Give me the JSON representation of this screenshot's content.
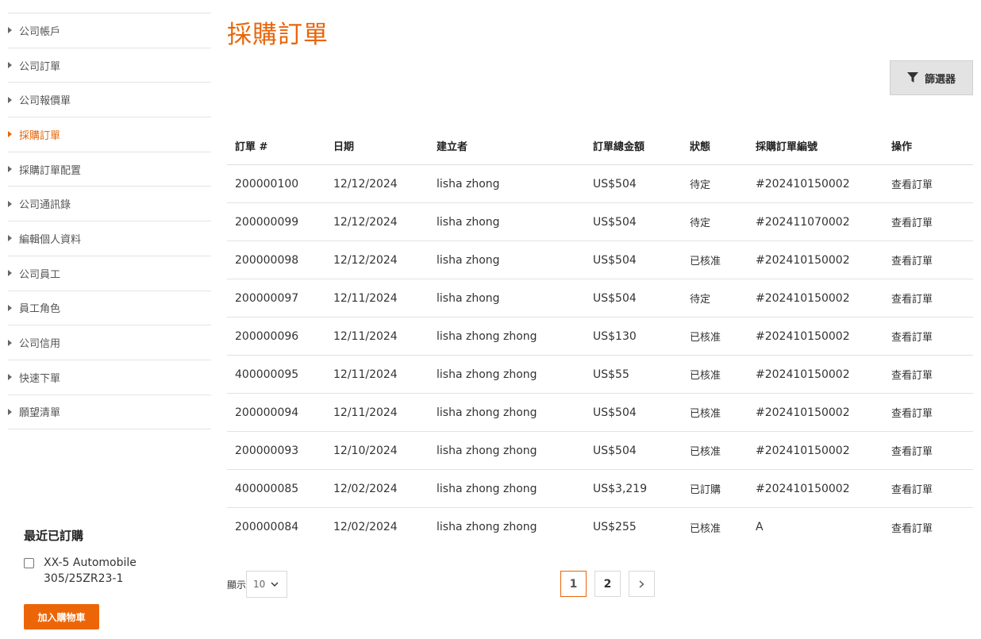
{
  "sidebar": {
    "items": [
      {
        "label": "公司帳戶",
        "active": false
      },
      {
        "label": "公司訂單",
        "active": false
      },
      {
        "label": "公司報價單",
        "active": false
      },
      {
        "label": "採購訂單",
        "active": true
      },
      {
        "label": "採購訂單配置",
        "active": false
      },
      {
        "label": "公司通訊錄",
        "active": false
      },
      {
        "label": "編輯個人資料",
        "active": false
      },
      {
        "label": "公司員工",
        "active": false
      },
      {
        "label": "員工角色",
        "active": false
      },
      {
        "label": "公司信用",
        "active": false
      },
      {
        "label": "快速下單",
        "active": false
      },
      {
        "label": "願望清單",
        "active": false
      }
    ]
  },
  "recent": {
    "title": "最近已訂購",
    "item_label": "XX-5 Automobile 305/25ZR23-1",
    "add_to_cart_label": "加入購物車"
  },
  "page": {
    "title": "採購訂單",
    "filter_label": "篩選器"
  },
  "table": {
    "headers": [
      "訂單 #",
      "日期",
      "建立者",
      "訂單總金額",
      "狀態",
      "採購訂單編號",
      "操作"
    ],
    "rows": [
      {
        "order": "200000100",
        "date": "12/12/2024",
        "creator": "lisha zhong",
        "total": "US$504",
        "status": "待定",
        "po": "#202410150002",
        "action": "查看訂單"
      },
      {
        "order": "200000099",
        "date": "12/12/2024",
        "creator": "lisha zhong",
        "total": "US$504",
        "status": "待定",
        "po": "#202411070002",
        "action": "查看訂單"
      },
      {
        "order": "200000098",
        "date": "12/12/2024",
        "creator": "lisha zhong",
        "total": "US$504",
        "status": "已核准",
        "po": "#202410150002",
        "action": "查看訂單"
      },
      {
        "order": "200000097",
        "date": "12/11/2024",
        "creator": "lisha zhong",
        "total": "US$504",
        "status": "待定",
        "po": "#202410150002",
        "action": "查看訂單"
      },
      {
        "order": "200000096",
        "date": "12/11/2024",
        "creator": "lisha zhong zhong",
        "total": "US$130",
        "status": "已核准",
        "po": "#202410150002",
        "action": "查看訂單"
      },
      {
        "order": "400000095",
        "date": "12/11/2024",
        "creator": "lisha zhong zhong",
        "total": "US$55",
        "status": "已核准",
        "po": "#202410150002",
        "action": "查看訂單"
      },
      {
        "order": "200000094",
        "date": "12/11/2024",
        "creator": "lisha zhong zhong",
        "total": "US$504",
        "status": "已核准",
        "po": "#202410150002",
        "action": "查看訂單"
      },
      {
        "order": "200000093",
        "date": "12/10/2024",
        "creator": "lisha zhong zhong",
        "total": "US$504",
        "status": "已核准",
        "po": "#202410150002",
        "action": "查看訂單"
      },
      {
        "order": "400000085",
        "date": "12/02/2024",
        "creator": "lisha zhong zhong",
        "total": "US$3,219",
        "status": "已訂購",
        "po": "#202410150002",
        "action": "查看訂單"
      },
      {
        "order": "200000084",
        "date": "12/02/2024",
        "creator": "lisha zhong zhong",
        "total": "US$255",
        "status": "已核准",
        "po": "A",
        "action": "查看訂單"
      }
    ]
  },
  "pagination": {
    "show_label": "顯示",
    "page_size": "10",
    "pages": [
      "1",
      "2"
    ],
    "current": "1"
  },
  "colors": {
    "accent": "#e8650a",
    "button": "#ec6608"
  }
}
